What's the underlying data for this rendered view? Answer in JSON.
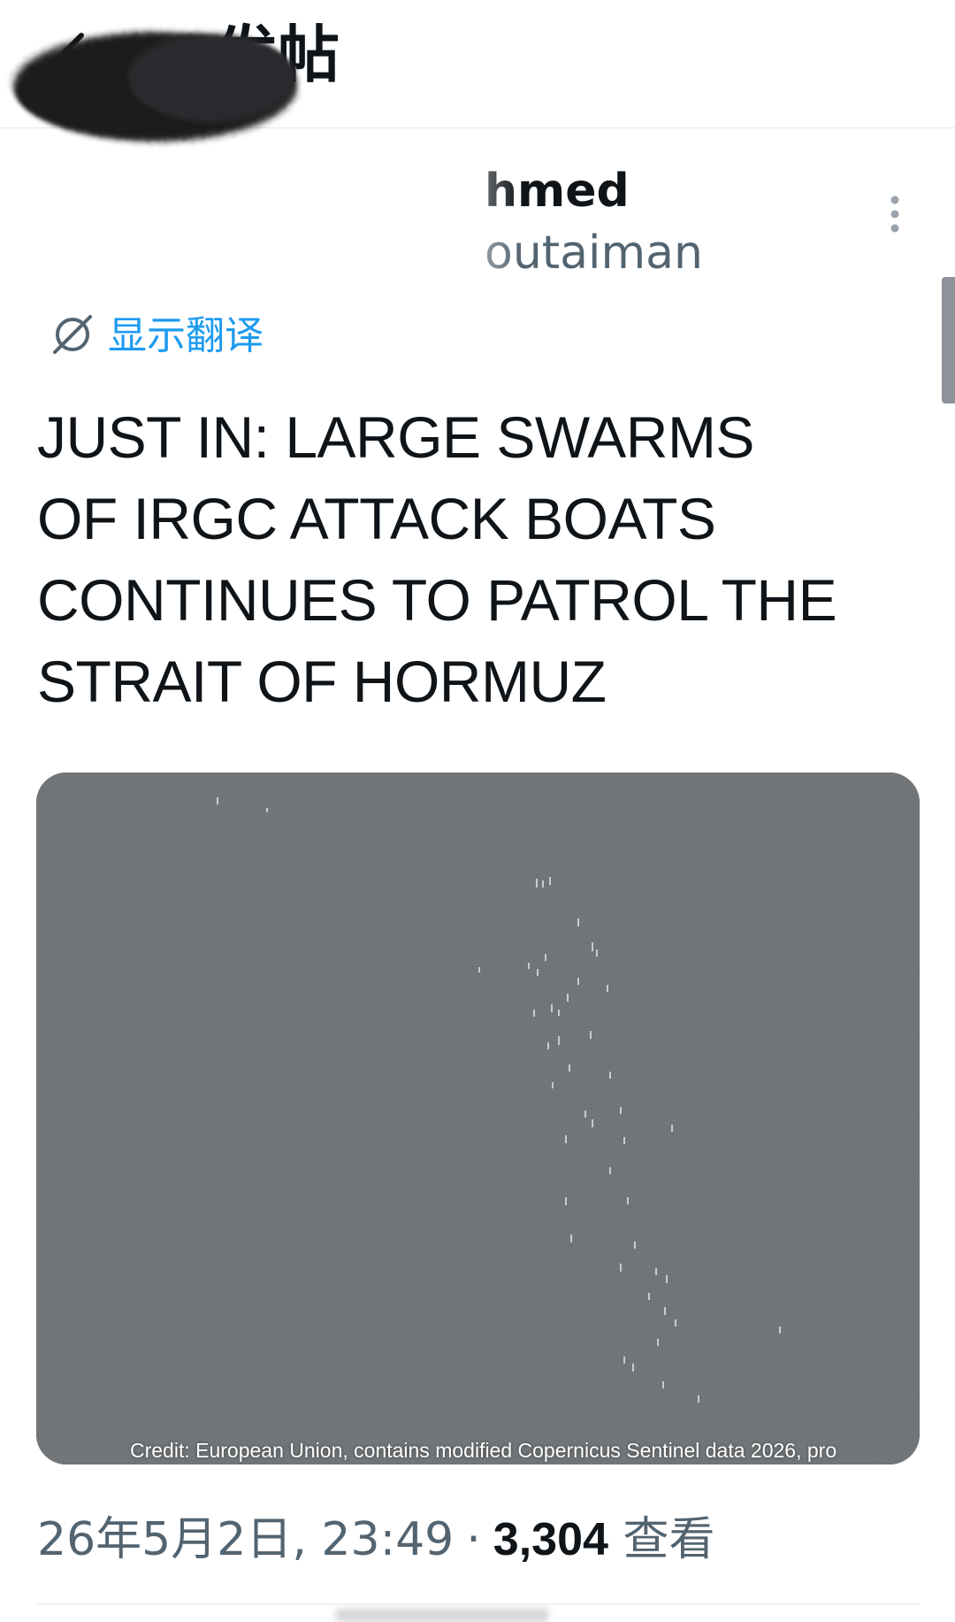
{
  "header": {
    "back_icon": "arrow-left-icon",
    "title": "发帖"
  },
  "author": {
    "display_name_fragment": "hmed",
    "handle_fragment": "outaiman",
    "more_icon": "more-vertical-icon"
  },
  "translate": {
    "icon": "globe-translate-icon",
    "label": "显示翻译"
  },
  "post": {
    "text_lines": [
      "JUST IN: LARGE SWARMS",
      "OF IRGC ATTACK BOATS",
      "CONTINUES TO PATROL THE",
      "STRAIT OF HORMUZ"
    ],
    "media": {
      "credit": "Credit: European Union, contains modified Copernicus Sentinel data 2026, pro"
    }
  },
  "meta": {
    "timestamp": "26年5月2日, 23:49",
    "separator": "·",
    "views_count": "3,304",
    "views_label": "查看"
  },
  "colors": {
    "accent": "#1d9bf0",
    "secondary_text": "#536471",
    "image_gray": "#6a6e71"
  }
}
